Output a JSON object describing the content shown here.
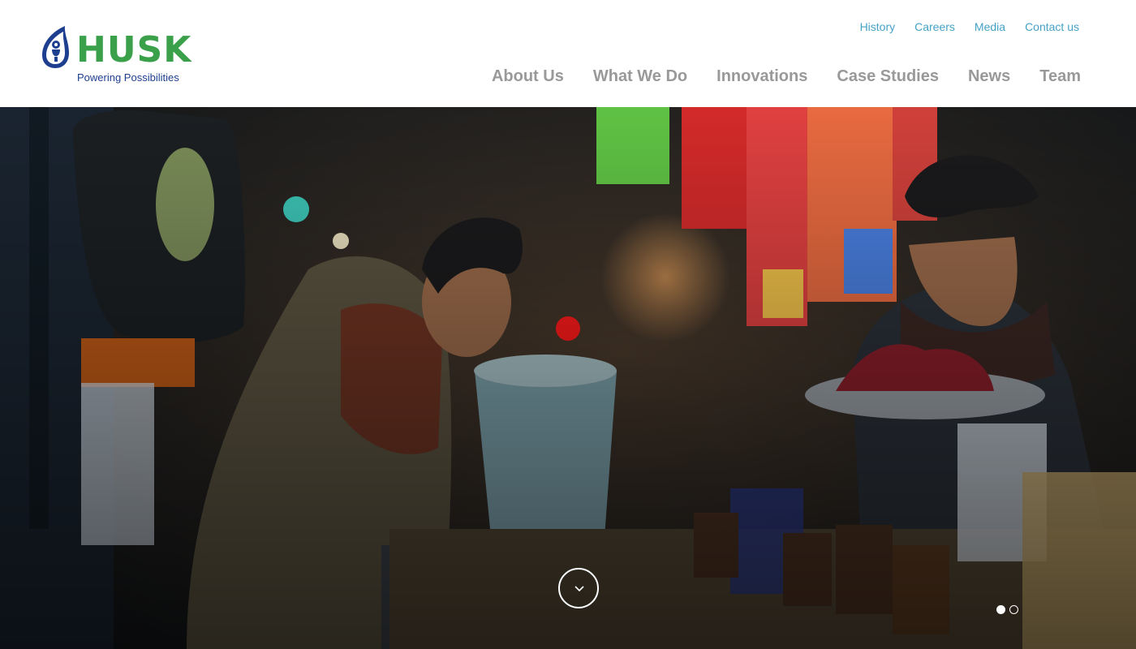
{
  "brand": {
    "name": "HUSK",
    "tagline": "Powering Possibilities",
    "green": "#3aa04a",
    "blue": "#1e3f8f"
  },
  "utility_nav": [
    {
      "label": "History"
    },
    {
      "label": "Careers"
    },
    {
      "label": "Media"
    },
    {
      "label": "Contact us"
    }
  ],
  "main_nav": [
    {
      "label": "About Us"
    },
    {
      "label": "What We Do"
    },
    {
      "label": "Innovations"
    },
    {
      "label": "Case Studies"
    },
    {
      "label": "News"
    },
    {
      "label": "Team"
    }
  ],
  "colors": {
    "utility_link": "#45a2c5",
    "main_link": "#999999"
  },
  "hero": {
    "scroll_icon": "chevron-down-icon",
    "slides_total": 2,
    "active_slide": 1
  }
}
